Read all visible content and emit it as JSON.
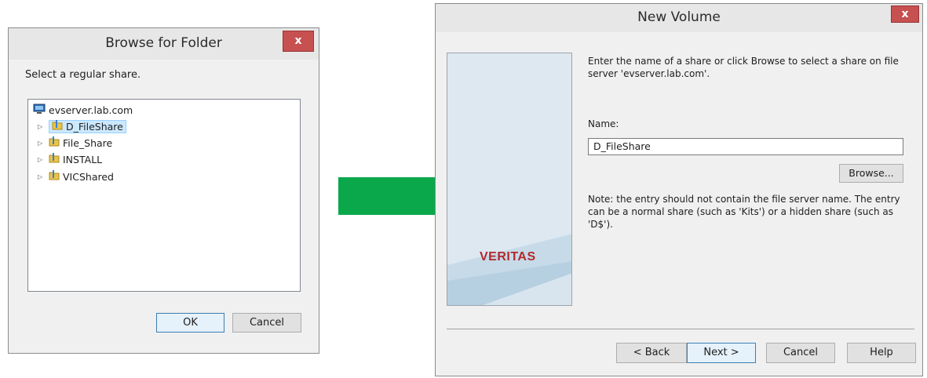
{
  "browse_dialog": {
    "title": "Browse for Folder",
    "close_label": "x",
    "instruction": "Select a regular share.",
    "tree": {
      "root": "evserver.lab.com",
      "items": [
        {
          "label": "D_FileShare",
          "selected": true
        },
        {
          "label": "File_Share",
          "selected": false
        },
        {
          "label": "INSTALL",
          "selected": false
        },
        {
          "label": "VICShared",
          "selected": false
        }
      ]
    },
    "ok_label": "OK",
    "cancel_label": "Cancel"
  },
  "arrow": {
    "color": "#0aa84a",
    "icon": "arrow-right-icon"
  },
  "wizard": {
    "title": "New Volume",
    "close_label": "x",
    "logo_text": "VERITAS",
    "intro": "Enter the name of a share or click Browse to select a share on file server 'evserver.lab.com'.",
    "name_label": "Name:",
    "name_value": "D_FileShare",
    "browse_label": "Browse...",
    "note": "Note: the entry should not contain the file server name. The entry can be a normal share (such as 'Kits') or a hidden share (such as 'D$').",
    "buttons": {
      "back": "< Back",
      "next": "Next >",
      "cancel": "Cancel",
      "help": "Help"
    }
  },
  "colors": {
    "close": "#c75050",
    "selection": "#cce8ff",
    "logo": "#b22a2a"
  }
}
